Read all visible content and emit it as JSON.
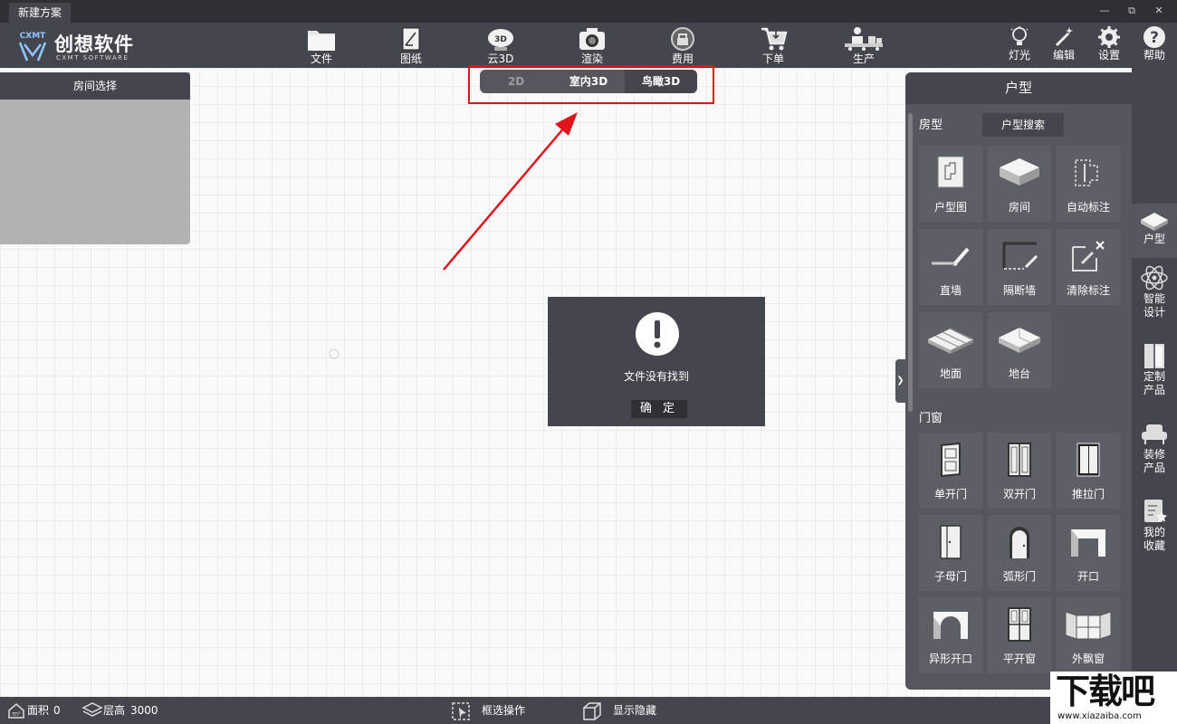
{
  "titlebar": {
    "doc_tab": "新建方案"
  },
  "logo": {
    "name": "创想软件",
    "sub": "CXMT SOFTWARE",
    "mark": "CXMT"
  },
  "toolbar": {
    "file": "文件",
    "drawings": "图纸",
    "cloud3d": "云3D",
    "cloud3d_badge": "3D",
    "render": "渲染",
    "cost": "费用",
    "order": "下单",
    "produce": "生产",
    "light": "灯光",
    "edit": "编辑",
    "settings": "设置",
    "help": "帮助"
  },
  "room_panel": {
    "title": "房间选择"
  },
  "view_switch": {
    "options": [
      "2D",
      "室内3D",
      "鸟瞰3D"
    ],
    "selected": "鸟瞰3D"
  },
  "dialog": {
    "message": "文件没有找到",
    "ok": "确 定"
  },
  "right_panel": {
    "title": "户型",
    "section_room": "房型",
    "search": "户型搜索",
    "room_tools": [
      "户型图",
      "房间",
      "自动标注",
      "直墙",
      "隔断墙",
      "清除标注",
      "地面",
      "地台"
    ],
    "section_doors": "门窗",
    "door_tools": [
      "单开门",
      "双开门",
      "推拉门",
      "子母门",
      "弧形门",
      "开口",
      "异形开口",
      "平开窗",
      "外飘窗"
    ]
  },
  "vnav": {
    "house": "户型",
    "smart_l1": "智能",
    "smart_l2": "设计",
    "custom_l1": "定制",
    "custom_l2": "产品",
    "decor_l1": "装修",
    "decor_l2": "产品",
    "fav_l1": "我的",
    "fav_l2": "收藏"
  },
  "status": {
    "area_label": "面积",
    "area_value": "0",
    "floor_label": "层高",
    "floor_value": "3000",
    "box_select": "框选操作",
    "show_hide": "显示隐藏"
  },
  "watermark": {
    "big": "下载吧",
    "small": "www.xiazaiba.com"
  },
  "colors": {
    "dark": "#44464d",
    "panel": "#55575e",
    "tile": "#5d5f66",
    "highlight": "#e0141b"
  }
}
